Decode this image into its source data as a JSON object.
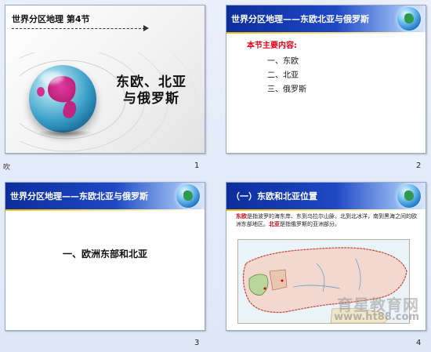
{
  "slides": [
    {
      "number": "1",
      "subtitle": "世界分区地理 第4节",
      "title_line1": "东欧、北亚",
      "title_line2": "与俄罗斯",
      "corner_note": "吹"
    },
    {
      "number": "2",
      "header": "世界分区地理——东欧北亚与俄罗斯",
      "section_title": "本节主要内容:",
      "items": [
        "一、东欧",
        "二、北亚",
        "三、俄罗斯"
      ]
    },
    {
      "number": "3",
      "header": "世界分区地理——东欧北亚与俄罗斯",
      "center_text": "一、欧洲东部和北亚"
    },
    {
      "number": "4",
      "header": "（一）东欧和北亚位置",
      "paragraph_red1": "东欧",
      "paragraph_part1": "是指波罗的海东岸、东到乌拉尔山脉，北到北冰洋，南到黑海之间的欧洲东部地区。",
      "paragraph_red2": "北亚",
      "paragraph_part2": "是指俄罗斯的亚洲部分。",
      "watermark": "育星教育网",
      "watermark_url": "www.ht88.com"
    }
  ],
  "colors": {
    "header_blue": "#0c2d9c",
    "accent_red": "#e0001b",
    "globe_magenta": "#c22580"
  }
}
